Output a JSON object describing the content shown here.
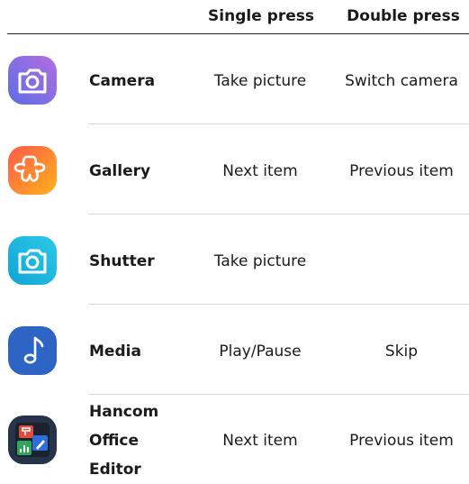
{
  "columns": {
    "single": "Single press",
    "double": "Double press"
  },
  "rows": [
    {
      "app": "Camera",
      "single": "Take picture",
      "double": "Switch camera",
      "icon": "camera-icon"
    },
    {
      "app": "Gallery",
      "single": "Next item",
      "double": "Previous item",
      "icon": "gallery-flower-icon"
    },
    {
      "app": "Shutter",
      "single": "Take picture",
      "double": "",
      "icon": "shutter-camera-icon"
    },
    {
      "app": "Media",
      "single": "Play/Pause",
      "double": "Skip",
      "icon": "music-note-icon"
    },
    {
      "app_lines": [
        "Hancom",
        "Office",
        "Editor"
      ],
      "single": "Next item",
      "double": "Previous item",
      "icon": "hancom-office-icon"
    }
  ],
  "colors": {
    "camera_gradient": [
      "#5b6ee6",
      "#b46de0"
    ],
    "gallery_gradient": [
      "#ff5a4a",
      "#ffb21c"
    ],
    "shutter_gradient": [
      "#12a4d6",
      "#2bc9e6"
    ],
    "media": "#2e64c4",
    "hancom_bg": "#26344a"
  }
}
